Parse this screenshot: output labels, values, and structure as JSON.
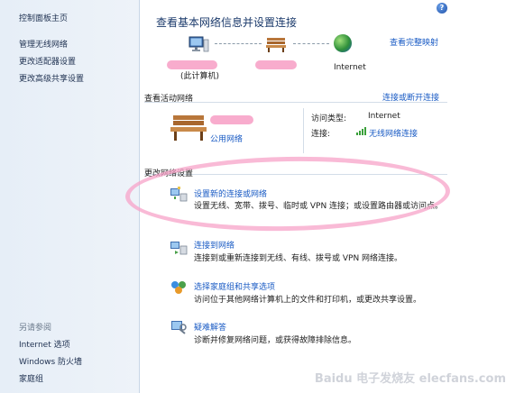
{
  "sidebar": {
    "home": "控制面板主页",
    "items": [
      "管理无线网络",
      "更改适配器设置",
      "更改高级共享设置"
    ],
    "see_also": {
      "title": "另请参阅",
      "items": [
        "Internet 选项",
        "Windows 防火墙",
        "家庭组"
      ]
    }
  },
  "main": {
    "help_icon": "?",
    "title": "查看基本网络信息并设置连接",
    "view_full_map": "查看完整映射",
    "map": {
      "computer_label": "(此计算机)",
      "internet_label": "Internet"
    },
    "active_networks": {
      "label": "查看活动网络",
      "connect_disconnect": "连接或断开连接",
      "network_type": "公用网络",
      "access_type_label": "访问类型:",
      "access_type_value": "Internet",
      "connection_label": "连接:",
      "connection_value": "无线网络连接"
    },
    "change_settings": {
      "label": "更改网络设置",
      "tasks": [
        {
          "link": "设置新的连接或网络",
          "desc": "设置无线、宽带、拨号、临时或 VPN 连接；或设置路由器或访问点。"
        },
        {
          "link": "连接到网络",
          "desc": "连接到或重新连接到无线、有线、拨号或 VPN 网络连接。"
        },
        {
          "link": "选择家庭组和共享选项",
          "desc": "访问位于其他网络计算机上的文件和打印机，或更改共享设置。"
        },
        {
          "link": "疑难解答",
          "desc": "诊断并修复网络问题，或获得故障排除信息。"
        }
      ]
    },
    "watermark": "Baidu 电子发烧友 elecfans.com"
  },
  "colors": {
    "link": "#1a5bc4",
    "sidebar_bg": "#e6eef7",
    "highlight": "#f7a3c8"
  }
}
